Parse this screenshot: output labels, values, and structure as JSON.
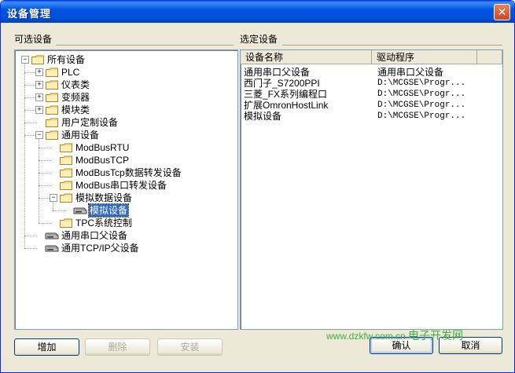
{
  "window": {
    "title": "设备管理",
    "close_glyph": "✕"
  },
  "left_panel": {
    "label": "可选设备",
    "tree": [
      {
        "label": "所有设备",
        "expander": "−",
        "icon": "folder",
        "level": 0
      },
      {
        "label": "PLC",
        "expander": "+",
        "icon": "folder",
        "level": 1
      },
      {
        "label": "仪表类",
        "expander": "+",
        "icon": "folder",
        "level": 1
      },
      {
        "label": "变频器",
        "expander": "+",
        "icon": "folder",
        "level": 1
      },
      {
        "label": "模块类",
        "expander": "+",
        "icon": "folder",
        "level": 1
      },
      {
        "label": "用户定制设备",
        "expander": "",
        "icon": "folder",
        "level": 1
      },
      {
        "label": "通用设备",
        "expander": "−",
        "icon": "folder",
        "level": 1
      },
      {
        "label": "ModBusRTU",
        "expander": "",
        "icon": "folder",
        "level": 2
      },
      {
        "label": "ModBusTCP",
        "expander": "",
        "icon": "folder",
        "level": 2
      },
      {
        "label": "ModBusTcp数据转发设备",
        "expander": "",
        "icon": "folder",
        "level": 2
      },
      {
        "label": "ModBus串口转发设备",
        "expander": "",
        "icon": "folder",
        "level": 2
      },
      {
        "label": "模拟数据设备",
        "expander": "−",
        "icon": "folder",
        "level": 2
      },
      {
        "label": "模拟设备",
        "expander": "",
        "icon": "device",
        "level": 3,
        "selected": true
      },
      {
        "label": "TPC系统控制",
        "expander": "",
        "icon": "folder",
        "level": 2
      },
      {
        "label": "通用串口父设备",
        "expander": "",
        "icon": "device",
        "level": 1
      },
      {
        "label": "通用TCP/IP父设备",
        "expander": "",
        "icon": "device",
        "level": 1
      }
    ]
  },
  "right_panel": {
    "label": "选定设备",
    "columns": [
      "设备名称",
      "驱动程序"
    ],
    "rows": [
      {
        "name": "通用串口父设备",
        "driver": "通用串口父设备"
      },
      {
        "name": "西门子_S7200PPI",
        "driver": "D:\\MCGSE\\Progr..."
      },
      {
        "name": "三菱_FX系列编程口",
        "driver": "D:\\MCGSE\\Progr..."
      },
      {
        "name": "扩展OmronHostLink",
        "driver": "D:\\MCGSE\\Progr..."
      },
      {
        "name": "模拟设备",
        "driver": "D:\\MCGSE\\Progr..."
      }
    ]
  },
  "buttons": {
    "add": "增加",
    "delete": "删除",
    "install": "安装",
    "ok": "确认",
    "cancel": "取消"
  },
  "watermark": {
    "url": "www.dzkfw.com.cn",
    "site": "电子开发网"
  }
}
